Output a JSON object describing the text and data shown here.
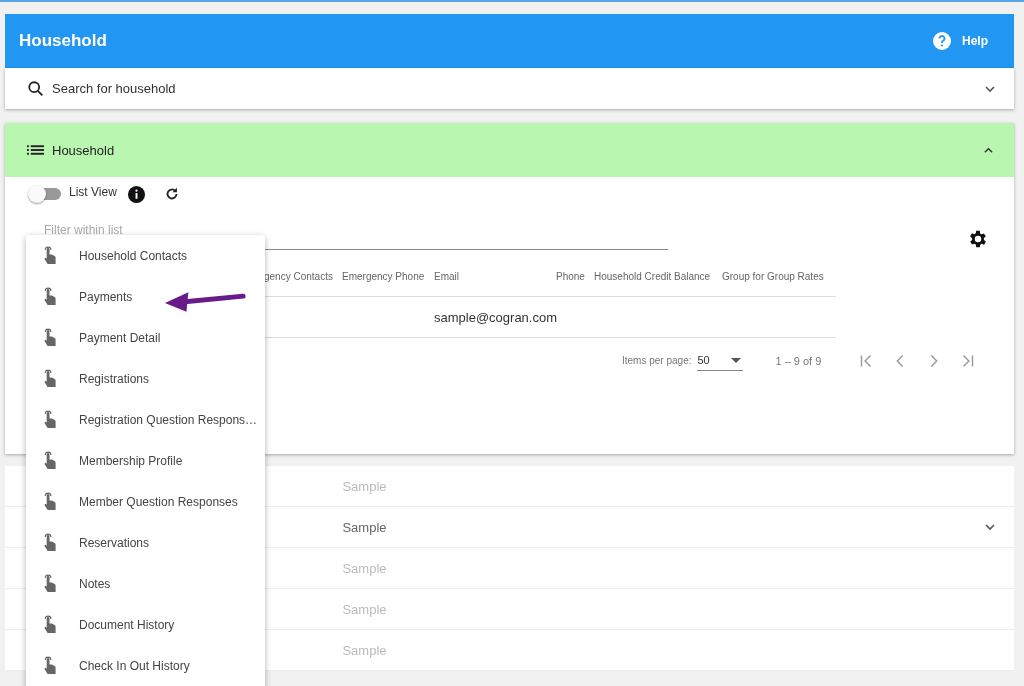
{
  "app_bar": {
    "title": "Household",
    "help": "Help"
  },
  "search": {
    "placeholder": "Search for household",
    "expanded": false
  },
  "panel": {
    "title": "Household",
    "expanded": true,
    "list_view": {
      "label": "List View",
      "on": false
    },
    "filter": {
      "placeholder": "Filter within list"
    },
    "table": {
      "columns": [
        "gency Contacts",
        "Emergency Phone",
        "Email",
        "Phone",
        "Household Credit Balance",
        "Group for Group Rates"
      ],
      "rows": [
        [
          "",
          "",
          "sample@cogran.com",
          "",
          "",
          ""
        ]
      ]
    },
    "paginator": {
      "label": "Items per page:",
      "page_size": "50",
      "range": "1 – 9 of 9"
    }
  },
  "list_rows": [
    {
      "text": "Sample",
      "expandable": false
    },
    {
      "text": "Sample",
      "expandable": true
    },
    {
      "text": "Sample",
      "expandable": false
    },
    {
      "text": "Sample",
      "expandable": false
    },
    {
      "text": "Sample",
      "expandable": false
    }
  ],
  "menu": {
    "items": [
      "Household Contacts",
      "Payments",
      "Payment Detail",
      "Registrations",
      "Registration Question Respons…",
      "Membership Profile",
      "Member Question Responses",
      "Reservations",
      "Notes",
      "Document History",
      "Check In Out History"
    ]
  }
}
